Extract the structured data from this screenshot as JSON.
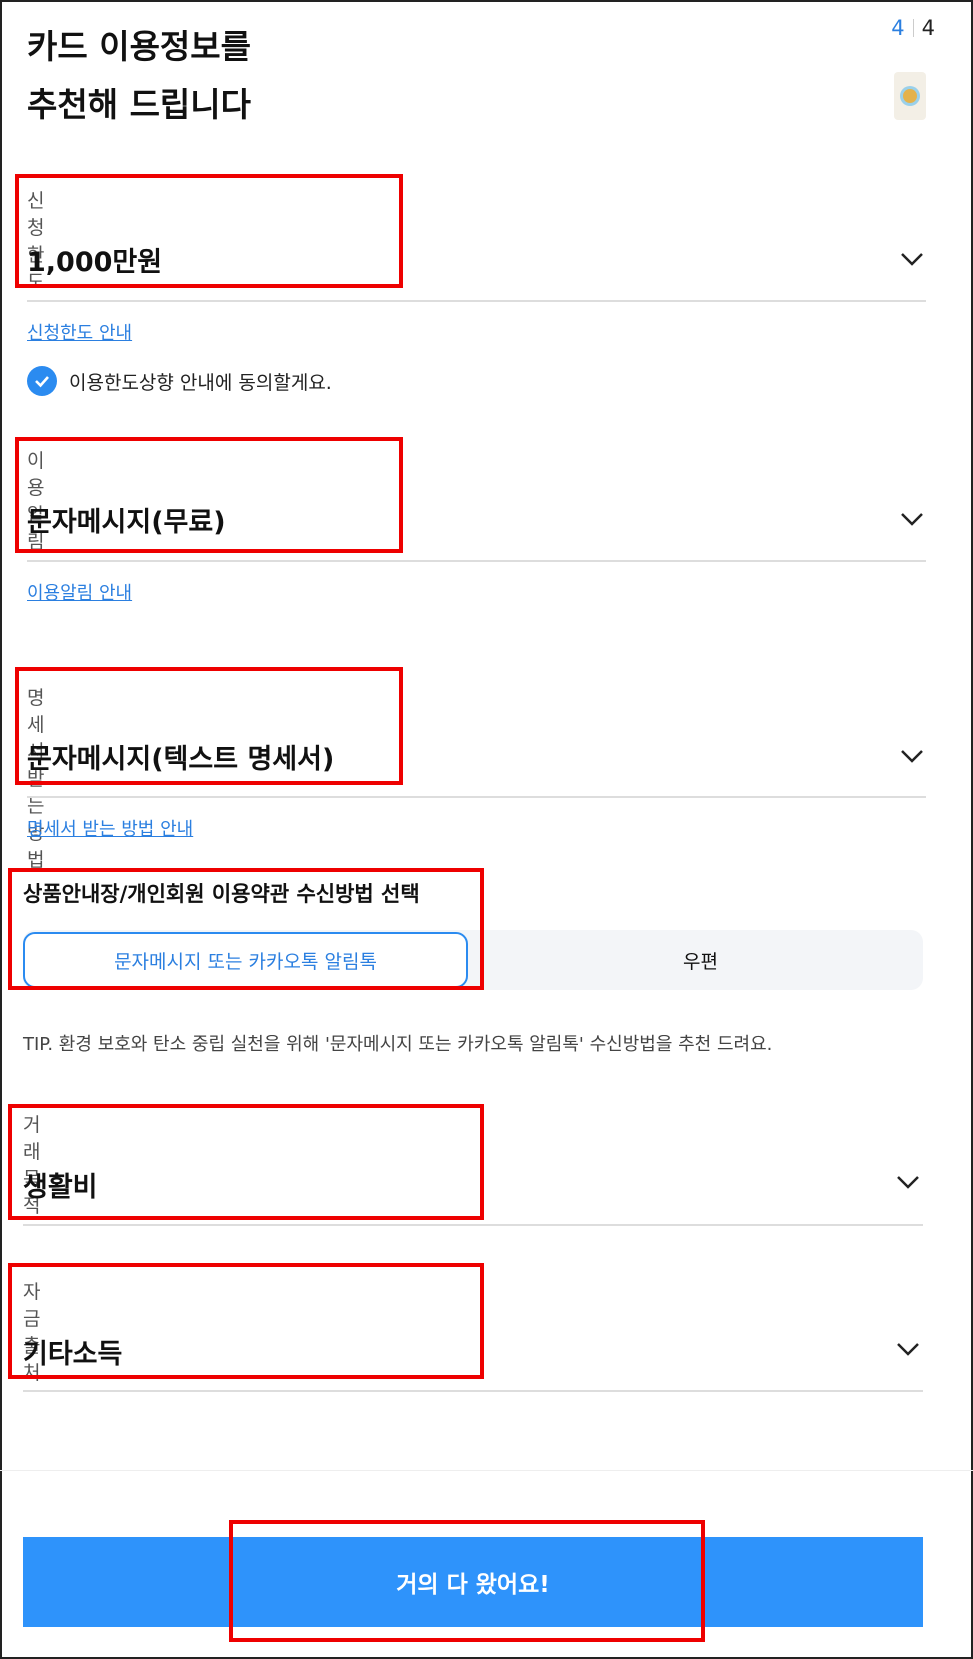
{
  "header": {
    "title_line1": "카드 이용정보를",
    "title_line2": "추천해 드립니다",
    "page_current": "4",
    "page_total": "4"
  },
  "fields": {
    "limit": {
      "label": "신청한도",
      "value": "1,000만원",
      "link": "신청한도 안내"
    },
    "agree": {
      "text": "이용한도상향 안내에 동의할게요.",
      "checked": true
    },
    "notify": {
      "label": "이용알림",
      "value": "문자메시지(무료)",
      "link": "이용알림 안내"
    },
    "statement": {
      "label": "명세서 받는 방법",
      "value": "문자메시지(텍스트 명세서)",
      "link": "명세서 받는 방법 안내"
    },
    "receive": {
      "title": "상품안내장/개인회원 이용약관 수신방법 선택",
      "options": [
        "문자메시지 또는 카카오톡 알림톡",
        "우편"
      ],
      "selected": "문자메시지 또는 카카오톡 알림톡"
    },
    "tip": "TIP. 환경 보호와 탄소 중립 실천을 위해 '문자메시지 또는 카카오톡 알림톡' 수신방법을 추천 드려요.",
    "purpose": {
      "label": "거래목적",
      "value": "생활비"
    },
    "source": {
      "label": "자금출처",
      "value": "기타소득"
    }
  },
  "cta": {
    "label": "거의 다 왔어요!"
  },
  "colors": {
    "accent": "#2e93fb",
    "link": "#2b7fe0",
    "highlight": "#e00000"
  },
  "icons": {
    "dropdown": "chevron-down-icon",
    "check": "check-circle-icon"
  }
}
